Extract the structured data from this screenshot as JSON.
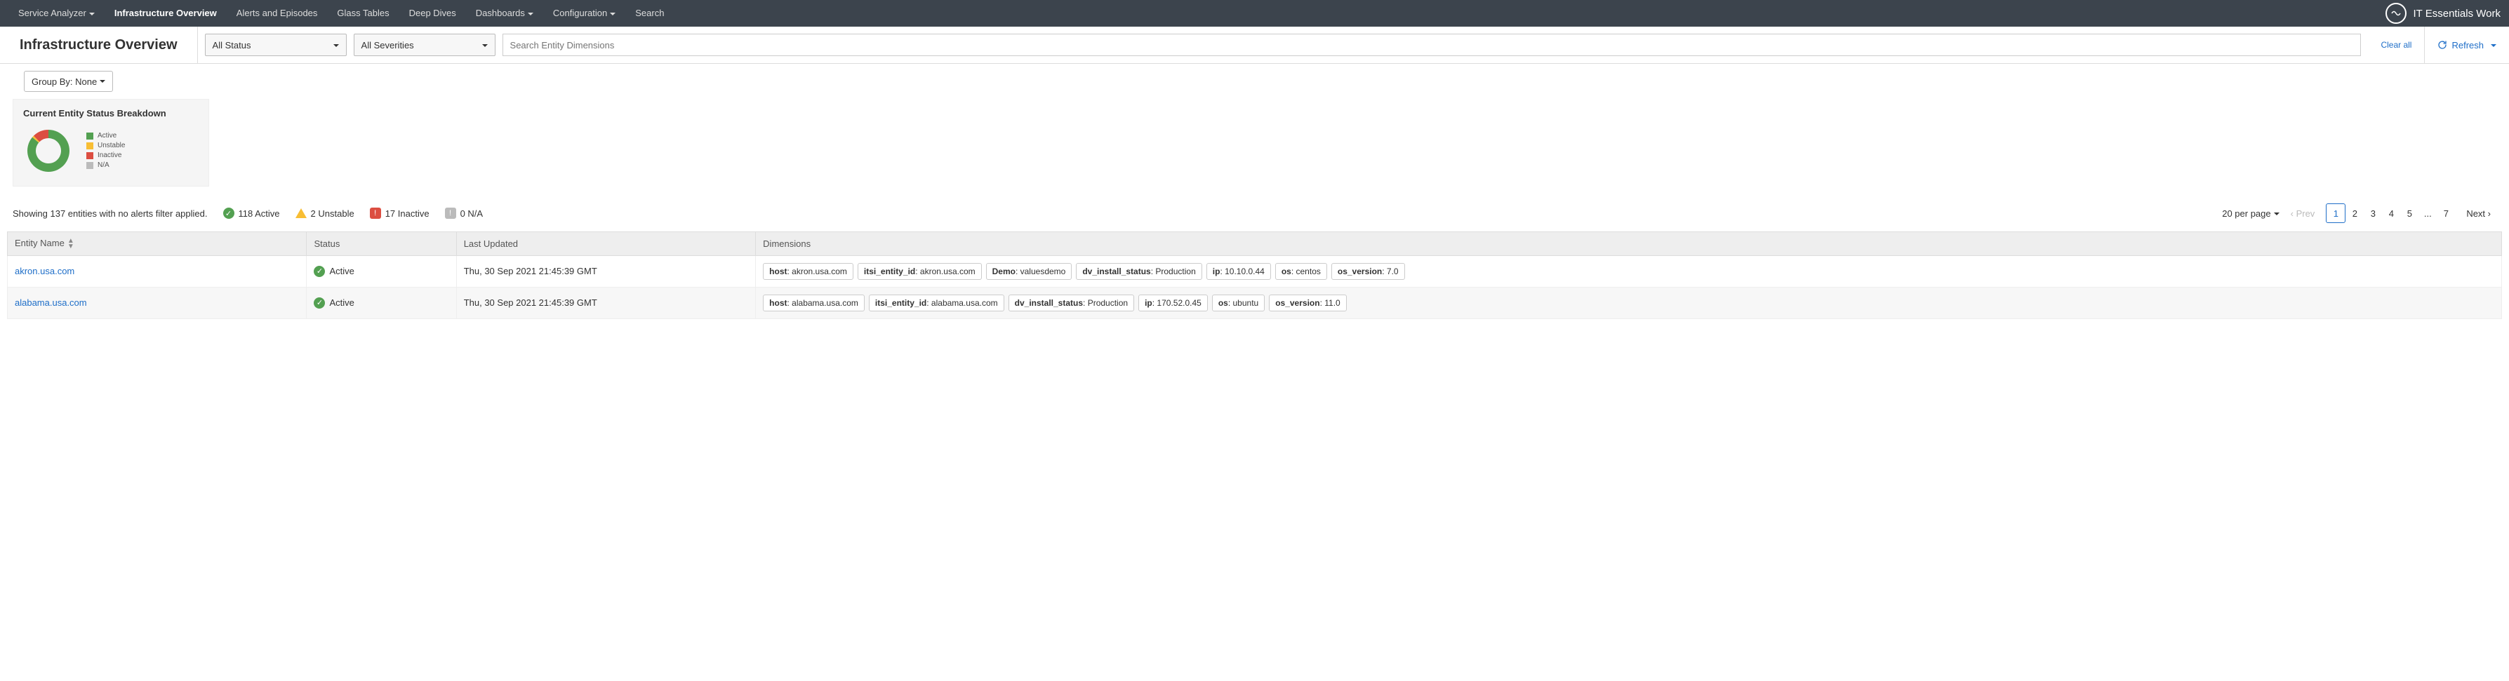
{
  "brand": "IT Essentials Work",
  "nav": [
    "Service Analyzer",
    "Infrastructure Overview",
    "Alerts and Episodes",
    "Glass Tables",
    "Deep Dives",
    "Dashboards",
    "Configuration",
    "Search"
  ],
  "nav_has_caret": [
    true,
    false,
    false,
    false,
    false,
    true,
    true,
    false
  ],
  "nav_active_index": 1,
  "page_title": "Infrastructure Overview",
  "filters": {
    "status": "All Status",
    "severity": "All Severities",
    "search_placeholder": "Search Entity Dimensions",
    "clear_all": "Clear all",
    "refresh": "Refresh"
  },
  "group_by": "Group By: None",
  "breakdown": {
    "title": "Current Entity Status Breakdown",
    "legend": [
      {
        "label": "Active",
        "color": "#53a051"
      },
      {
        "label": "Unstable",
        "color": "#f8be34"
      },
      {
        "label": "Inactive",
        "color": "#dc4e41"
      },
      {
        "label": "N/A",
        "color": "#bbbbbb"
      }
    ]
  },
  "chart_data": {
    "type": "pie",
    "title": "Current Entity Status Breakdown",
    "categories": [
      "Active",
      "Unstable",
      "Inactive",
      "N/A"
    ],
    "values": [
      118,
      2,
      17,
      0
    ],
    "colors": [
      "#53a051",
      "#f8be34",
      "#dc4e41",
      "#bbbbbb"
    ]
  },
  "summary": {
    "showing": "Showing 137 entities with no alerts filter applied.",
    "active": "118 Active",
    "unstable": "2 Unstable",
    "inactive": "17 Inactive",
    "na": "0 N/A"
  },
  "pager": {
    "per_page": "20 per page",
    "prev": "Prev",
    "next": "Next",
    "pages": [
      "1",
      "2",
      "3",
      "4",
      "5",
      "...",
      "7"
    ],
    "active_index": 0
  },
  "table": {
    "headers": [
      "Entity Name",
      "Status",
      "Last Updated",
      "Dimensions"
    ],
    "rows": [
      {
        "name": "akron.usa.com",
        "status": "Active",
        "updated": "Thu, 30 Sep 2021 21:45:39 GMT",
        "dims": [
          {
            "k": "host",
            "v": "akron.usa.com"
          },
          {
            "k": "itsi_entity_id",
            "v": "akron.usa.com"
          },
          {
            "k": "Demo",
            "v": "valuesdemo"
          },
          {
            "k": "dv_install_status",
            "v": "Production"
          },
          {
            "k": "ip",
            "v": "10.10.0.44"
          },
          {
            "k": "os",
            "v": "centos"
          },
          {
            "k": "os_version",
            "v": "7.0"
          }
        ]
      },
      {
        "name": "alabama.usa.com",
        "status": "Active",
        "updated": "Thu, 30 Sep 2021 21:45:39 GMT",
        "dims": [
          {
            "k": "host",
            "v": "alabama.usa.com"
          },
          {
            "k": "itsi_entity_id",
            "v": "alabama.usa.com"
          },
          {
            "k": "dv_install_status",
            "v": "Production"
          },
          {
            "k": "ip",
            "v": "170.52.0.45"
          },
          {
            "k": "os",
            "v": "ubuntu"
          },
          {
            "k": "os_version",
            "v": "11.0"
          }
        ]
      }
    ]
  }
}
